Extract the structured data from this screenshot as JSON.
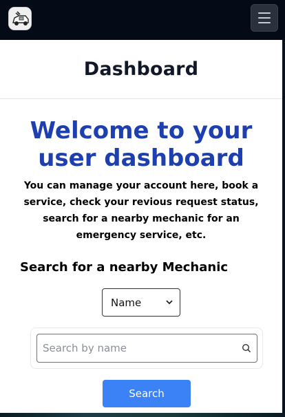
{
  "navbar": {
    "logo_icon": "mechanic-van-logo-icon",
    "menu_icon": "hamburger-menu-icon"
  },
  "header": {
    "title": "Dashboard"
  },
  "welcome": {
    "heading": "Welcome to your user dashboard",
    "description": "You can manage your account here, book a service, check your revious request status, search for a nearby mechanic for an emergency service, etc."
  },
  "search_section": {
    "title": "Search for a nearby Mechanic",
    "filter_selected": "Name",
    "input_placeholder": "Search by name",
    "input_value": "",
    "search_icon": "magnifier-icon",
    "button_label": "Search"
  },
  "colors": {
    "navbar_bg": "#050b16",
    "heading_blue": "#1e40af",
    "button_blue": "#3b82f6"
  }
}
